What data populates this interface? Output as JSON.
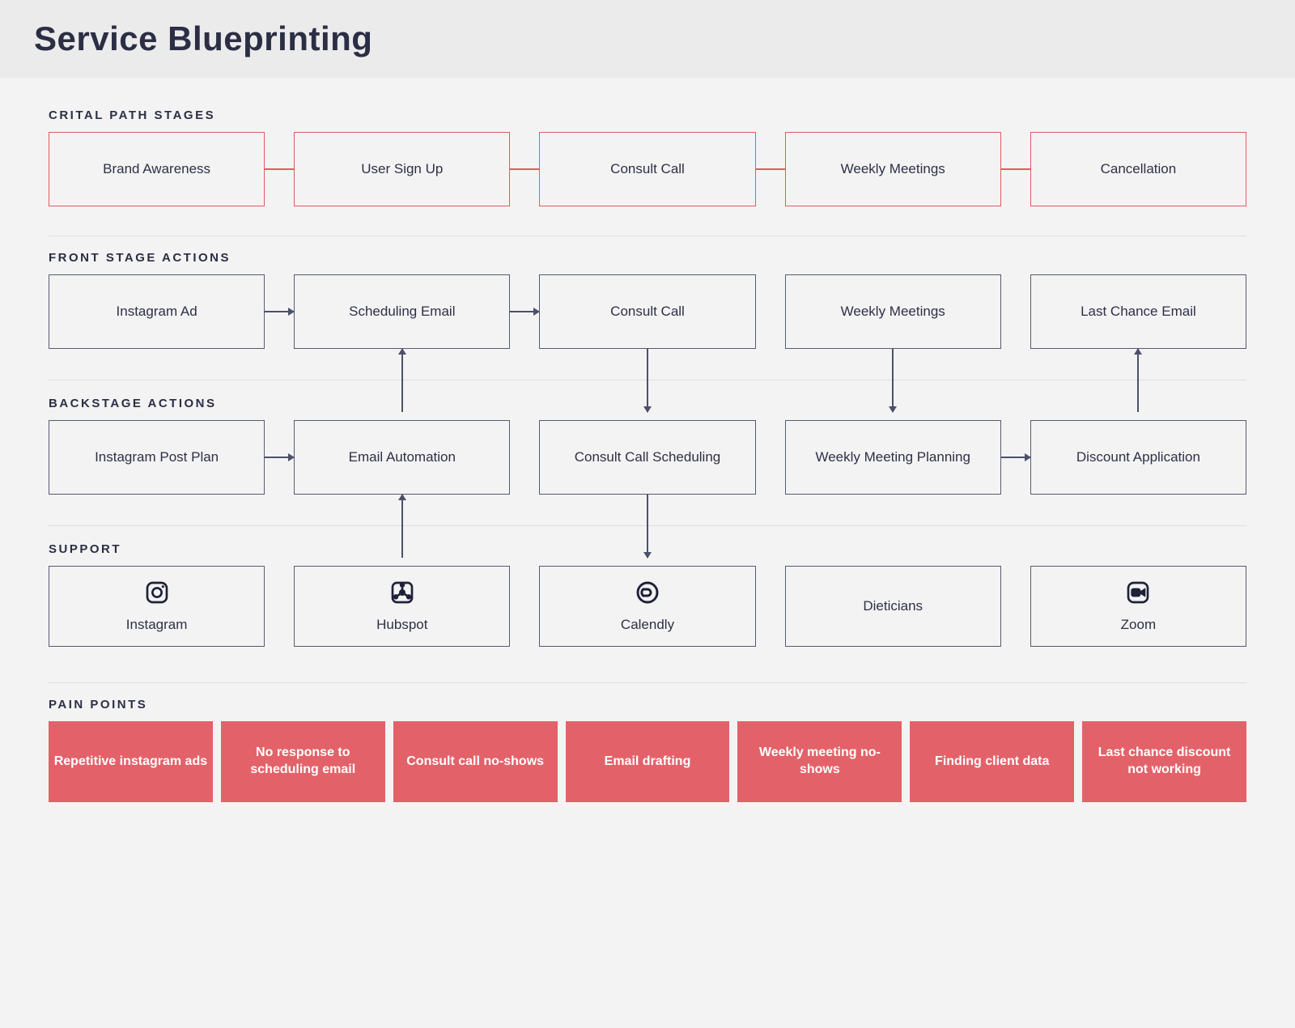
{
  "title": "Service Blueprinting",
  "sections": {
    "critical_path": {
      "label": "CRITAL PATH STAGES",
      "items": [
        "Brand Awareness",
        "User Sign Up",
        "Consult Call",
        "Weekly Meetings",
        "Cancellation"
      ]
    },
    "front_stage": {
      "label": "FRONT STAGE ACTIONS",
      "items": [
        "Instagram Ad",
        "Scheduling Email",
        "Consult Call",
        "Weekly Meetings",
        "Last Chance Email"
      ]
    },
    "backstage": {
      "label": "BACKSTAGE ACTIONS",
      "items": [
        "Instagram Post Plan",
        "Email Automation",
        "Consult Call Scheduling",
        "Weekly Meeting Planning",
        "Discount Application"
      ]
    },
    "support": {
      "label": "SUPPORT",
      "items": [
        {
          "label": "Instagram",
          "icon": "instagram-icon"
        },
        {
          "label": "Hubspot",
          "icon": "hubspot-icon"
        },
        {
          "label": "Calendly",
          "icon": "calendly-icon"
        },
        {
          "label": "Dieticians",
          "icon": ""
        },
        {
          "label": "Zoom",
          "icon": "zoom-icon"
        }
      ]
    },
    "pain_points": {
      "label": "PAIN POINTS",
      "items": [
        "Repetitive instagram ads",
        "No response to scheduling email",
        "Consult call no-shows",
        "Email drafting",
        "Weekly meeting no-shows",
        "Finding client data",
        "Last chance discount not working"
      ]
    }
  },
  "colors": {
    "accent_red": "#e15b5e",
    "box_border": "#555a71",
    "pain": "#e36269"
  }
}
